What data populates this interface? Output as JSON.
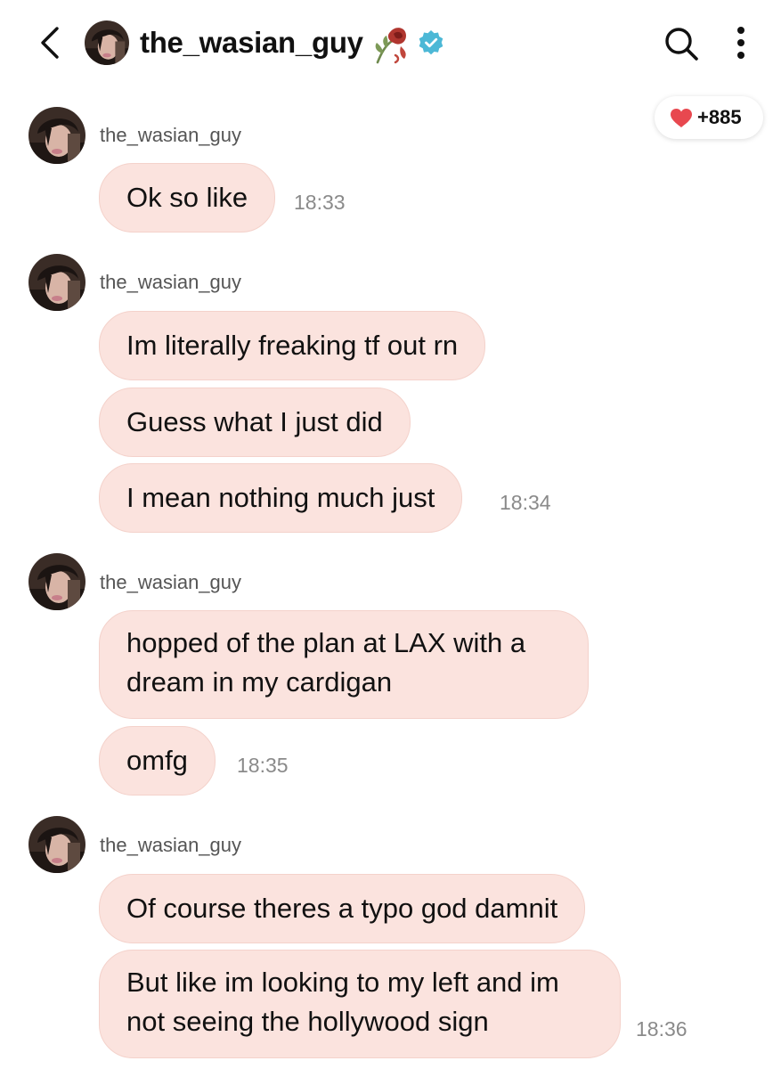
{
  "header": {
    "username": "the_wasian_guy",
    "back_icon": "chevron-left-icon",
    "rose_icon": "wilted-rose-icon",
    "verified_icon": "verified-badge-icon",
    "search_icon": "search-icon",
    "more_icon": "more-vertical-icon"
  },
  "reaction": {
    "icon": "heart-icon",
    "count": "+885",
    "color": "#e8484f"
  },
  "colors": {
    "bubble_background": "#fbe3de",
    "bubble_border": "#f4d2cb",
    "verified_badge": "#4cb8d6"
  },
  "groups": [
    {
      "sender": "the_wasian_guy",
      "messages": [
        "Ok so like"
      ],
      "time": "18:33"
    },
    {
      "sender": "the_wasian_guy",
      "messages": [
        "Im literally freaking tf out rn",
        "Guess what I just did",
        "I mean nothing much just"
      ],
      "time": "18:34"
    },
    {
      "sender": "the_wasian_guy",
      "messages": [
        "hopped of the plan at LAX with a dream in my cardigan",
        "omfg"
      ],
      "time": "18:35"
    },
    {
      "sender": "the_wasian_guy",
      "messages": [
        "Of course theres a typo god damnit",
        "But like im looking to my left and im not seeing the hollywood sign"
      ],
      "time": "18:36"
    }
  ]
}
